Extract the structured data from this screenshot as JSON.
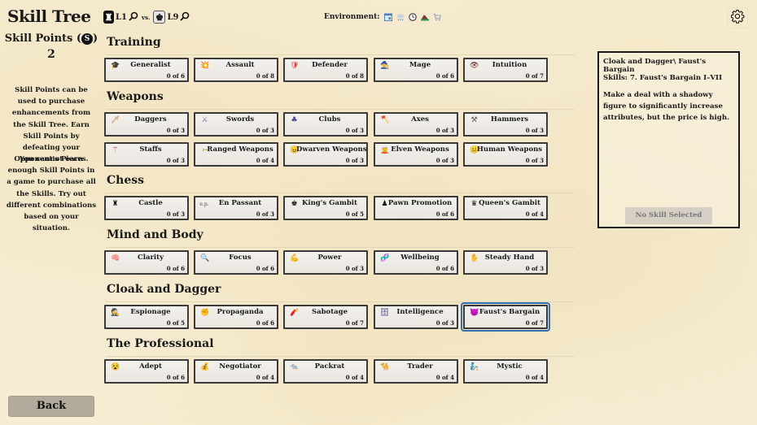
{
  "title": "Skill Tree",
  "skill_points": {
    "label": "Skill Points",
    "coin_symbol": "S",
    "value": "2"
  },
  "help": [
    "Skill Points can be used to purchase enhancements from the Skill Tree. Earn Skill Points by defeating your Opponent's Pieces.",
    "You cannot earn enough Skill Points in a game to purchase all the Skills. Try out different combinations based on your situation."
  ],
  "players": {
    "player": {
      "piece": "rook-black",
      "glyph": "♜",
      "level": "L1"
    },
    "vs": "vs.",
    "opponent": {
      "piece": "king-white",
      "glyph": "♚",
      "level": "L9"
    }
  },
  "environment": {
    "label": "Environment:",
    "icons": [
      "calendar-icon",
      "rain-cloud-icon",
      "clock-icon",
      "mountain-icon",
      "cart-icon"
    ]
  },
  "sections": [
    {
      "title": "Training",
      "skills": [
        {
          "name": "Generalist",
          "icon": "graduation-cap-icon",
          "glyph": "🎓",
          "progress": "0 of 6"
        },
        {
          "name": "Assault",
          "icon": "explosion-icon",
          "glyph": "💥",
          "progress": "0 of 8"
        },
        {
          "name": "Defender",
          "icon": "shield-icon",
          "glyph": "🛡",
          "progress": "0 of 8"
        },
        {
          "name": "Mage",
          "icon": "mage-icon",
          "glyph": "🧙",
          "progress": "0 of 6"
        },
        {
          "name": "Intuition",
          "icon": "eye-icon",
          "glyph": "👁",
          "progress": "0 of 7"
        }
      ]
    },
    {
      "title": "Weapons",
      "skills": [
        {
          "name": "Daggers",
          "icon": "dagger-icon",
          "glyph": "🗡",
          "progress": "0 of 3"
        },
        {
          "name": "Swords",
          "icon": "crossed-swords-icon",
          "glyph": "⚔",
          "progress": "0 of 3"
        },
        {
          "name": "Clubs",
          "icon": "club-icon",
          "glyph": "♣",
          "progress": "0 of 3"
        },
        {
          "name": "Axes",
          "icon": "axe-icon",
          "glyph": "🪓",
          "progress": "0 of 3"
        },
        {
          "name": "Hammers",
          "icon": "hammers-icon",
          "glyph": "⚒",
          "progress": "0 of 3"
        },
        {
          "name": "Staffs",
          "icon": "staff-icon",
          "glyph": "⚚",
          "progress": "0 of 3"
        },
        {
          "name": "Ranged Weapons",
          "icon": "arrow-icon",
          "glyph": "➳",
          "progress": "0 of 4"
        },
        {
          "name": "Dwarven Weapons",
          "icon": "dwarf-icon",
          "glyph": "😠",
          "progress": "0 of 3"
        },
        {
          "name": "Elven Weapons",
          "icon": "elf-icon",
          "glyph": "🧝",
          "progress": "0 of 3"
        },
        {
          "name": "Human Weapons",
          "icon": "human-icon",
          "glyph": "😐",
          "progress": "0 of 3"
        }
      ]
    },
    {
      "title": "Chess",
      "skills": [
        {
          "name": "Castle",
          "icon": "rook-icon",
          "glyph": "♜",
          "progress": "0 of 3"
        },
        {
          "name": "En Passant",
          "icon": "ep-icon",
          "glyph": "e.p.",
          "progress": "0 of 3"
        },
        {
          "name": "King's Gambit",
          "icon": "king-icon",
          "glyph": "♚",
          "progress": "0 of 5"
        },
        {
          "name": "Pawn Promotion",
          "icon": "pawn-icon",
          "glyph": "♟",
          "progress": "0 of 6"
        },
        {
          "name": "Queen's Gambit",
          "icon": "queen-icon",
          "glyph": "♛",
          "progress": "0 of 4"
        }
      ]
    },
    {
      "title": "Mind and Body",
      "skills": [
        {
          "name": "Clarity",
          "icon": "brain-icon",
          "glyph": "🧠",
          "progress": "0 of 6"
        },
        {
          "name": "Focus",
          "icon": "magnifier-icon",
          "glyph": "🔍",
          "progress": "0 of 6"
        },
        {
          "name": "Power",
          "icon": "flexed-bicep-icon",
          "glyph": "💪",
          "progress": "0 of 3"
        },
        {
          "name": "Wellbeing",
          "icon": "dna-icon",
          "glyph": "🧬",
          "progress": "0 of 6"
        },
        {
          "name": "Steady Hand",
          "icon": "hand-icon",
          "glyph": "✋",
          "progress": "0 of 3"
        }
      ]
    },
    {
      "title": "Cloak and Dagger",
      "skills": [
        {
          "name": "Espionage",
          "icon": "spy-icon",
          "glyph": "🕵",
          "progress": "0 of 5"
        },
        {
          "name": "Propaganda",
          "icon": "fist-icon",
          "glyph": "✊",
          "progress": "0 of 6"
        },
        {
          "name": "Sabotage",
          "icon": "dynamite-icon",
          "glyph": "🧨",
          "progress": "0 of 7"
        },
        {
          "name": "Intelligence",
          "icon": "file-cabinet-icon",
          "glyph": "🗄",
          "progress": "0 of 3"
        },
        {
          "name": "Faust's Bargain",
          "icon": "devil-icon",
          "glyph": "😈",
          "progress": "0 of 7",
          "selected": true
        }
      ]
    },
    {
      "title": "The Professional",
      "skills": [
        {
          "name": "Adept",
          "icon": "adept-icon",
          "glyph": "😵",
          "progress": "0 of 6"
        },
        {
          "name": "Negotiator",
          "icon": "money-bag-icon",
          "glyph": "💰",
          "progress": "0 of 4"
        },
        {
          "name": "Packrat",
          "icon": "rat-icon",
          "glyph": "🐀",
          "progress": "0 of 4"
        },
        {
          "name": "Trader",
          "icon": "camel-icon",
          "glyph": "🐪",
          "progress": "0 of 4"
        },
        {
          "name": "Mystic",
          "icon": "mystic-icon",
          "glyph": "🧞",
          "progress": "0 of 4"
        }
      ]
    }
  ],
  "detail": {
    "path": "Cloak and Dagger\\ Faust's Bargain",
    "skills": "Skills: 7. Faust's Bargain I–VII",
    "description": "Make a deal with a shadowy figure to significantly increase attributes, but the price is high.",
    "button": "No Skill Selected"
  },
  "back_button": "Back",
  "colors": {
    "selected_outline": "#2f6fb3",
    "card_border": "#3a3a3a",
    "background": "#f6ecd2"
  }
}
